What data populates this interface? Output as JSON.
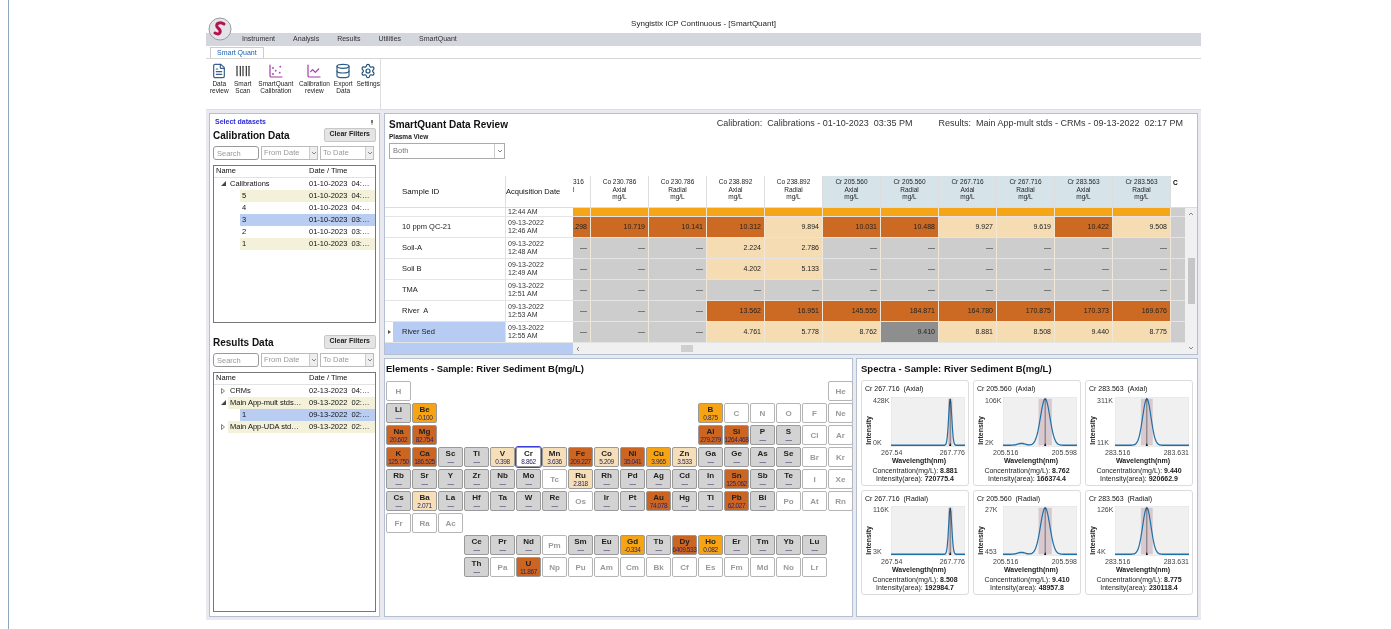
{
  "window": {
    "title": "Syngistix ICP Continuous - [SmartQuant]"
  },
  "menu": [
    "Instrument",
    "Analysis",
    "Results",
    "Utilities",
    "SmartQuant"
  ],
  "ribbon": {
    "tabs": [
      {
        "label": "Smart Quant",
        "selected": true
      }
    ],
    "buttons": [
      {
        "label": "Data review",
        "kind": "document"
      },
      {
        "label": "Smart Scan",
        "kind": "barcode"
      },
      {
        "label": "SmartQuant Calibration",
        "kind": "scatter"
      },
      {
        "label": "Calibration review",
        "kind": "line"
      },
      {
        "label": "Export Data",
        "kind": "database"
      },
      {
        "label": "Settings",
        "kind": "gear"
      }
    ]
  },
  "datasets": {
    "link": "Select datasets",
    "calibration": {
      "title": "Calibration Data",
      "clear": "Clear Filters",
      "search_placeholder": "Search",
      "from_placeholder": "From Date",
      "to_placeholder": "To Date",
      "columns": [
        "Name",
        "Date / Time"
      ],
      "tree": [
        {
          "name": "Calibrations",
          "date": "01-10-2023  04:…",
          "expanded": true,
          "selected": false,
          "tinted": false,
          "children": [
            {
              "name": "5",
              "date": "01-10-2023  04:…",
              "selected": false,
              "tinted": true
            },
            {
              "name": "4",
              "date": "01-10-2023  04:…",
              "selected": false,
              "tinted": false
            },
            {
              "name": "3",
              "date": "01-10-2023  03:…",
              "selected": true,
              "tinted": false
            },
            {
              "name": "2",
              "date": "01-10-2023  03:…",
              "selected": false,
              "tinted": false
            },
            {
              "name": "1",
              "date": "01-10-2023  03:…",
              "selected": false,
              "tinted": true
            }
          ]
        }
      ]
    },
    "results": {
      "title": "Results Data",
      "clear": "Clear Filters",
      "search_placeholder": "Search",
      "from_placeholder": "From Date",
      "to_placeholder": "To Date",
      "columns": [
        "Name",
        "Date / Time"
      ],
      "tree": [
        {
          "name": "CRMs",
          "date": "02-13-2023  04:…",
          "expanded": false,
          "selected": false,
          "tinted": false
        },
        {
          "name": "Main App-mult stds…",
          "date": "09-13-2022  02:…",
          "expanded": true,
          "selected": false,
          "tinted": true,
          "children": [
            {
              "name": "1",
              "date": "09-13-2022  02:…",
              "selected": true,
              "tinted": false
            }
          ]
        },
        {
          "name": "Main App-UDA std…",
          "date": "09-13-2022  02:…",
          "expanded": false,
          "selected": false,
          "tinted": true
        }
      ]
    }
  },
  "review": {
    "title": "SmartQuant Data Review",
    "plasma_label": "Plasma View",
    "plasma_value": "Both",
    "calibration_info": "Calibration:  Calibrations - 01-10-2023  03:35 PM",
    "results_info": "Results:  Main App-mult stds - CRMs - 09-13-2022  02:17 PM",
    "table": {
      "columns": [
        "Sample ID",
        "Acquisition Date"
      ],
      "data_columns": [
        {
          "lines": [
            "316",
            "l"
          ],
          "partial": true,
          "highlighted": false
        },
        {
          "lines": [
            "Co 230.786",
            "Axial",
            "mg/L"
          ],
          "partial": false,
          "highlighted": false
        },
        {
          "lines": [
            "Co 230.786",
            "Radial",
            "mg/L"
          ],
          "partial": false,
          "highlighted": false
        },
        {
          "lines": [
            "Co 238.892",
            "Axial",
            "mg/L"
          ],
          "partial": false,
          "highlighted": false
        },
        {
          "lines": [
            "Co 238.892",
            "Radial",
            "mg/L"
          ],
          "partial": false,
          "highlighted": false
        },
        {
          "lines": [
            "Cr 205.560",
            "Axial",
            "mg/L"
          ],
          "partial": false,
          "highlighted": true
        },
        {
          "lines": [
            "Cr 205.560",
            "Radial",
            "mg/L"
          ],
          "partial": false,
          "highlighted": true
        },
        {
          "lines": [
            "Cr 267.716",
            "Axial",
            "mg/L"
          ],
          "partial": false,
          "highlighted": true
        },
        {
          "lines": [
            "Cr 267.716",
            "Radial",
            "mg/L"
          ],
          "partial": false,
          "highlighted": true
        },
        {
          "lines": [
            "Cr 283.563",
            "Axial",
            "mg/L"
          ],
          "partial": false,
          "highlighted": true
        },
        {
          "lines": [
            "Cr 283.563",
            "Radial",
            "mg/L"
          ],
          "partial": false,
          "highlighted": true
        },
        {
          "lines": [
            "C"
          ],
          "partial": true,
          "highlighted": false
        }
      ],
      "rows": [
        {
          "partial": true,
          "time": "12:44 AM",
          "selected": false,
          "cells": [
            {
              "color": "#f6a516"
            },
            {
              "color": "#f6a516"
            },
            {
              "color": "#f6a516"
            },
            {
              "color": "#f6a516"
            },
            {
              "color": "#f6a516"
            },
            {
              "color": "#f6a516"
            },
            {
              "color": "#f6a516"
            },
            {
              "color": "#f6a516"
            },
            {
              "color": "#f6a516"
            },
            {
              "color": "#f6a516"
            },
            {
              "color": "#f6a516"
            }
          ]
        },
        {
          "partial": false,
          "sample": "10 ppm QC-21",
          "date": "09-13-2022",
          "time": "12:46 AM",
          "selected": false,
          "cells": [
            {
              "color": "#cc6a24",
              "value": ".298"
            },
            {
              "color": "#cc6a24",
              "value": "10.719"
            },
            {
              "color": "#cc6a24",
              "value": "10.141"
            },
            {
              "color": "#cc6a24",
              "value": "10.312"
            },
            {
              "color": "#f5dcb2",
              "value": "9.894"
            },
            {
              "color": "#cc6a24",
              "value": "10.031"
            },
            {
              "color": "#cc6a24",
              "value": "10.488"
            },
            {
              "color": "#f5dcb2",
              "value": "9.927"
            },
            {
              "color": "#f5dcb2",
              "value": "9.619"
            },
            {
              "color": "#cc6a24",
              "value": "10.422"
            },
            {
              "color": "#f5dcb2",
              "value": "9.508"
            }
          ]
        },
        {
          "partial": false,
          "sample": "Soil-A",
          "date": "09-13-2022",
          "time": "12:48 AM",
          "selected": false,
          "cells": [
            {
              "color": "#cdcdcd",
              "value": "—"
            },
            {
              "color": "#cdcdcd",
              "value": "—"
            },
            {
              "color": "#cdcdcd",
              "value": "—"
            },
            {
              "color": "#f5dcb2",
              "value": "2.224"
            },
            {
              "color": "#f5dcb2",
              "value": "2.786"
            },
            {
              "color": "#cdcdcd",
              "value": "—"
            },
            {
              "color": "#cdcdcd",
              "value": "—"
            },
            {
              "color": "#cdcdcd",
              "value": "—"
            },
            {
              "color": "#cdcdcd",
              "value": "—"
            },
            {
              "color": "#cdcdcd",
              "value": "—"
            },
            {
              "color": "#cdcdcd",
              "value": "—"
            }
          ]
        },
        {
          "partial": false,
          "sample": "Soil B",
          "date": "09-13-2022",
          "time": "12:49 AM",
          "selected": false,
          "cells": [
            {
              "color": "#cdcdcd",
              "value": "—"
            },
            {
              "color": "#cdcdcd",
              "value": "—"
            },
            {
              "color": "#cdcdcd",
              "value": "—"
            },
            {
              "color": "#f5dcb2",
              "value": "4.202"
            },
            {
              "color": "#f5dcb2",
              "value": "5.133"
            },
            {
              "color": "#cdcdcd",
              "value": "—"
            },
            {
              "color": "#cdcdcd",
              "value": "—"
            },
            {
              "color": "#cdcdcd",
              "value": "—"
            },
            {
              "color": "#cdcdcd",
              "value": "—"
            },
            {
              "color": "#cdcdcd",
              "value": "—"
            },
            {
              "color": "#cdcdcd",
              "value": "—"
            }
          ]
        },
        {
          "partial": false,
          "sample": "TMA",
          "date": "09-13-2022",
          "time": "12:51 AM",
          "selected": false,
          "cells": [
            {
              "color": "#cdcdcd",
              "value": "—"
            },
            {
              "color": "#cdcdcd",
              "value": "—"
            },
            {
              "color": "#cdcdcd",
              "value": "—"
            },
            {
              "color": "#cdcdcd",
              "value": "—"
            },
            {
              "color": "#cdcdcd",
              "value": "—"
            },
            {
              "color": "#cdcdcd",
              "value": "—"
            },
            {
              "color": "#cdcdcd",
              "value": "—"
            },
            {
              "color": "#cdcdcd",
              "value": "—"
            },
            {
              "color": "#cdcdcd",
              "value": "—"
            },
            {
              "color": "#cdcdcd",
              "value": "—"
            },
            {
              "color": "#cdcdcd",
              "value": "—"
            }
          ]
        },
        {
          "partial": false,
          "sample": "River  A",
          "date": "09-13-2022",
          "time": "12:53 AM",
          "selected": false,
          "cells": [
            {
              "color": "#cdcdcd",
              "value": "—"
            },
            {
              "color": "#cdcdcd",
              "value": "—"
            },
            {
              "color": "#cdcdcd",
              "value": "—"
            },
            {
              "color": "#cc6a24",
              "value": "13.562"
            },
            {
              "color": "#cc6a24",
              "value": "16.951"
            },
            {
              "color": "#cc6a24",
              "value": "145.555"
            },
            {
              "color": "#cc6a24",
              "value": "184.871"
            },
            {
              "color": "#cc6a24",
              "value": "164.780"
            },
            {
              "color": "#cc6a24",
              "value": "170.875"
            },
            {
              "color": "#cc6a24",
              "value": "170.373"
            },
            {
              "color": "#cc6a24",
              "value": "169.676"
            }
          ]
        },
        {
          "partial": false,
          "sample": "River Sed",
          "date": "09-13-2022",
          "time": "12:55 AM",
          "selected": true,
          "cells": [
            {
              "color": "#cdcdcd",
              "value": "—"
            },
            {
              "color": "#cdcdcd",
              "value": "—"
            },
            {
              "color": "#cdcdcd",
              "value": "—"
            },
            {
              "color": "#f5dcb2",
              "value": "4.761"
            },
            {
              "color": "#f5dcb2",
              "value": "5.778"
            },
            {
              "color": "#f5dcb2",
              "value": "8.762"
            },
            {
              "color": "#8e8e8e",
              "value": "9.410"
            },
            {
              "color": "#f5dcb2",
              "value": "8.881"
            },
            {
              "color": "#f5dcb2",
              "value": "8.508"
            },
            {
              "color": "#f5dcb2",
              "value": "9.440"
            },
            {
              "color": "#f5dcb2",
              "value": "8.775"
            }
          ]
        }
      ]
    }
  },
  "elements": {
    "title": "Elements - Sample: River Sediment B(mg/L)",
    "rows": [
      [
        {
          "symbol": "H",
          "color": "#ffffff",
          "selected": false
        },
        null,
        null,
        null,
        null,
        null,
        null,
        null,
        null,
        null,
        null,
        null,
        null,
        null,
        null,
        null,
        null,
        {
          "symbol": "He",
          "color": "#ffffff",
          "selected": false
        }
      ],
      [
        {
          "symbol": "Li",
          "color": "#d3d3d3",
          "value": "—",
          "selected": false
        },
        {
          "symbol": "Be",
          "color": "#f6a414",
          "value": "-0.100",
          "selected": false
        },
        null,
        null,
        null,
        null,
        null,
        null,
        null,
        null,
        null,
        null,
        {
          "symbol": "B",
          "color": "#f6a414",
          "value": "0.875",
          "selected": false
        },
        {
          "symbol": "C",
          "color": "#ffffff",
          "selected": false
        },
        {
          "symbol": "N",
          "color": "#ffffff",
          "selected": false
        },
        {
          "symbol": "O",
          "color": "#ffffff",
          "selected": false
        },
        {
          "symbol": "F",
          "color": "#ffffff",
          "selected": false
        },
        {
          "symbol": "Ne",
          "color": "#ffffff",
          "selected": false
        }
      ],
      [
        {
          "symbol": "Na",
          "color": "#cd6522",
          "value": "20.602",
          "selected": false
        },
        {
          "symbol": "Mg",
          "color": "#cd6522",
          "value": "82.754",
          "selected": false
        },
        null,
        null,
        null,
        null,
        null,
        null,
        null,
        null,
        null,
        null,
        {
          "symbol": "Al",
          "color": "#cd6522",
          "value": "279.279",
          "selected": false
        },
        {
          "symbol": "Si",
          "color": "#cd6522",
          "value": "1264.468",
          "selected": false
        },
        {
          "symbol": "P",
          "color": "#d3d3d3",
          "value": "—",
          "selected": false
        },
        {
          "symbol": "S",
          "color": "#d3d3d3",
          "value": "—",
          "selected": false
        },
        {
          "symbol": "Cl",
          "color": "#ffffff",
          "selected": false
        },
        {
          "symbol": "Ar",
          "color": "#ffffff",
          "selected": false
        }
      ],
      [
        {
          "symbol": "K",
          "color": "#cd6522",
          "value": "125.750",
          "selected": false
        },
        {
          "symbol": "Ca",
          "color": "#cd6522",
          "value": "186.525",
          "selected": false
        },
        {
          "symbol": "Sc",
          "color": "#d3d3d3",
          "value": "—",
          "selected": false
        },
        {
          "symbol": "Ti",
          "color": "#d3d3d3",
          "value": "—",
          "selected": false
        },
        {
          "symbol": "V",
          "color": "#f6dfb8",
          "value": "0.398",
          "selected": false
        },
        {
          "symbol": "Cr",
          "color": "#ffffff",
          "value": "8.862",
          "selected": true
        },
        {
          "symbol": "Mn",
          "color": "#f6dfb8",
          "value": "3.636",
          "selected": false
        },
        {
          "symbol": "Fe",
          "color": "#cd6522",
          "value": "209.227",
          "selected": false
        },
        {
          "symbol": "Co",
          "color": "#f6dfb8",
          "value": "5.209",
          "selected": false
        },
        {
          "symbol": "Ni",
          "color": "#cd6522",
          "value": "35.041",
          "selected": false
        },
        {
          "symbol": "Cu",
          "color": "#f6a414",
          "value": "3.965",
          "selected": false
        },
        {
          "symbol": "Zn",
          "color": "#f6dfb8",
          "value": "3.533",
          "selected": false
        },
        {
          "symbol": "Ga",
          "color": "#d3d3d3",
          "value": "—",
          "selected": false
        },
        {
          "symbol": "Ge",
          "color": "#d3d3d3",
          "value": "—",
          "selected": false
        },
        {
          "symbol": "As",
          "color": "#d3d3d3",
          "value": "—",
          "selected": false
        },
        {
          "symbol": "Se",
          "color": "#d3d3d3",
          "value": "—",
          "selected": false
        },
        {
          "symbol": "Br",
          "color": "#ffffff",
          "selected": false
        },
        {
          "symbol": "Kr",
          "color": "#ffffff",
          "selected": false
        }
      ],
      [
        {
          "symbol": "Rb",
          "color": "#d3d3d3",
          "value": "—",
          "selected": false
        },
        {
          "symbol": "Sr",
          "color": "#d3d3d3",
          "value": "—",
          "selected": false
        },
        {
          "symbol": "Y",
          "color": "#d3d3d3",
          "value": "—",
          "selected": false
        },
        {
          "symbol": "Zr",
          "color": "#d3d3d3",
          "value": "—",
          "selected": false
        },
        {
          "symbol": "Nb",
          "color": "#d3d3d3",
          "value": "—",
          "selected": false
        },
        {
          "symbol": "Mo",
          "color": "#d3d3d3",
          "value": "—",
          "selected": false
        },
        {
          "symbol": "Tc",
          "color": "#ffffff",
          "selected": false
        },
        {
          "symbol": "Ru",
          "color": "#f6dfb8",
          "value": "2.818",
          "selected": false
        },
        {
          "symbol": "Rh",
          "color": "#d3d3d3",
          "value": "—",
          "selected": false
        },
        {
          "symbol": "Pd",
          "color": "#d3d3d3",
          "value": "—",
          "selected": false
        },
        {
          "symbol": "Ag",
          "color": "#d3d3d3",
          "value": "—",
          "selected": false
        },
        {
          "symbol": "Cd",
          "color": "#d3d3d3",
          "value": "—",
          "selected": false
        },
        {
          "symbol": "In",
          "color": "#d3d3d3",
          "value": "—",
          "selected": false
        },
        {
          "symbol": "Sn",
          "color": "#cd6522",
          "value": "125.062",
          "selected": false
        },
        {
          "symbol": "Sb",
          "color": "#d3d3d3",
          "value": "—",
          "selected": false
        },
        {
          "symbol": "Te",
          "color": "#d3d3d3",
          "value": "—",
          "selected": false
        },
        {
          "symbol": "I",
          "color": "#ffffff",
          "selected": false
        },
        {
          "symbol": "Xe",
          "color": "#ffffff",
          "selected": false
        }
      ],
      [
        {
          "symbol": "Cs",
          "color": "#d3d3d3",
          "value": "—",
          "selected": false
        },
        {
          "symbol": "Ba",
          "color": "#f6dfb8",
          "value": "2.071",
          "selected": false
        },
        {
          "symbol": "La",
          "color": "#d3d3d3",
          "value": "—",
          "selected": false
        },
        {
          "symbol": "Hf",
          "color": "#d3d3d3",
          "value": "—",
          "selected": false
        },
        {
          "symbol": "Ta",
          "color": "#d3d3d3",
          "value": "—",
          "selected": false
        },
        {
          "symbol": "W",
          "color": "#d3d3d3",
          "value": "—",
          "selected": false
        },
        {
          "symbol": "Re",
          "color": "#d3d3d3",
          "value": "—",
          "selected": false
        },
        {
          "symbol": "Os",
          "color": "#ffffff",
          "selected": false
        },
        {
          "symbol": "Ir",
          "color": "#d3d3d3",
          "value": "—",
          "selected": false
        },
        {
          "symbol": "Pt",
          "color": "#d3d3d3",
          "value": "—",
          "selected": false
        },
        {
          "symbol": "Au",
          "color": "#cd6522",
          "value": "74.078",
          "selected": false
        },
        {
          "symbol": "Hg",
          "color": "#d3d3d3",
          "value": "—",
          "selected": false
        },
        {
          "symbol": "Tl",
          "color": "#d3d3d3",
          "value": "—",
          "selected": false
        },
        {
          "symbol": "Pb",
          "color": "#cd6522",
          "value": "62.027",
          "selected": false
        },
        {
          "symbol": "Bi",
          "color": "#d3d3d3",
          "value": "—",
          "selected": false
        },
        {
          "symbol": "Po",
          "color": "#ffffff",
          "selected": false
        },
        {
          "symbol": "At",
          "color": "#ffffff",
          "selected": false
        },
        {
          "symbol": "Rn",
          "color": "#ffffff",
          "selected": false
        }
      ],
      [
        {
          "symbol": "Fr",
          "color": "#ffffff",
          "selected": false
        },
        {
          "symbol": "Ra",
          "color": "#ffffff",
          "selected": false
        },
        {
          "symbol": "Ac",
          "color": "#ffffff",
          "selected": false
        }
      ],
      [
        null,
        null,
        null,
        {
          "symbol": "Ce",
          "color": "#d3d3d3",
          "value": "—",
          "selected": false
        },
        {
          "symbol": "Pr",
          "color": "#d3d3d3",
          "value": "—",
          "selected": false
        },
        {
          "symbol": "Nd",
          "color": "#d3d3d3",
          "value": "—",
          "selected": false
        },
        {
          "symbol": "Pm",
          "color": "#ffffff",
          "selected": false
        },
        {
          "symbol": "Sm",
          "color": "#d3d3d3",
          "value": "—",
          "selected": false
        },
        {
          "symbol": "Eu",
          "color": "#d3d3d3",
          "value": "—",
          "selected": false
        },
        {
          "symbol": "Gd",
          "color": "#f6a414",
          "value": "-0.334",
          "selected": false
        },
        {
          "symbol": "Tb",
          "color": "#d3d3d3",
          "value": "—",
          "selected": false
        },
        {
          "symbol": "Dy",
          "color": "#cd6522",
          "value": "6409.533",
          "selected": false
        },
        {
          "symbol": "Ho",
          "color": "#f6a414",
          "value": "0.082",
          "selected": false
        },
        {
          "symbol": "Er",
          "color": "#d3d3d3",
          "value": "—",
          "selected": false
        },
        {
          "symbol": "Tm",
          "color": "#d3d3d3",
          "value": "—",
          "selected": false
        },
        {
          "symbol": "Yb",
          "color": "#d3d3d3",
          "value": "—",
          "selected": false
        },
        {
          "symbol": "Lu",
          "color": "#d3d3d3",
          "value": "—",
          "selected": false
        }
      ],
      [
        null,
        null,
        null,
        {
          "symbol": "Th",
          "color": "#d3d3d3",
          "value": "—",
          "selected": false
        },
        {
          "symbol": "Pa",
          "color": "#ffffff",
          "selected": false
        },
        {
          "symbol": "U",
          "color": "#cd6522",
          "value": "11.867",
          "selected": false
        },
        {
          "symbol": "Np",
          "color": "#ffffff",
          "selected": false
        },
        {
          "symbol": "Pu",
          "color": "#ffffff",
          "selected": false
        },
        {
          "symbol": "Am",
          "color": "#ffffff",
          "selected": false
        },
        {
          "symbol": "Cm",
          "color": "#ffffff",
          "selected": false
        },
        {
          "symbol": "Bk",
          "color": "#ffffff",
          "selected": false
        },
        {
          "symbol": "Cf",
          "color": "#ffffff",
          "selected": false
        },
        {
          "symbol": "Es",
          "color": "#ffffff",
          "selected": false
        },
        {
          "symbol": "Fm",
          "color": "#ffffff",
          "selected": false
        },
        {
          "symbol": "Md",
          "color": "#ffffff",
          "selected": false
        },
        {
          "symbol": "No",
          "color": "#ffffff",
          "selected": false
        },
        {
          "symbol": "Lr",
          "color": "#ffffff",
          "selected": false
        }
      ]
    ]
  },
  "spectra": {
    "title": "Spectra - Sample: River Sediment B(mg/L)",
    "plots": [
      {
        "title": "Cr 267.716  (Axial)",
        "y_max": "428K",
        "y_min": "0K",
        "x_min": "267.54",
        "x_max": "267.776",
        "y_label": "Intensity",
        "x_label": "Wavelength(nm)",
        "footer": "Concentration(mg/L): **8.881**  Intensity(area): **720775.4**"
      },
      {
        "title": "Cr 205.560  (Axial)",
        "y_max": "106K",
        "y_min": "2K",
        "x_min": "205.516",
        "x_max": "205.598",
        "y_label": "Intensity",
        "x_label": "Wavelength(nm)",
        "footer": "Concentration(mg/L): **8.762**  Intensity(area): **166374.4**"
      },
      {
        "title": "Cr 283.563  (Axial)",
        "y_max": "311K",
        "y_min": "11K",
        "x_min": "283.516",
        "x_max": "283.631",
        "y_label": "Intensity",
        "x_label": "Wavelength(nm)",
        "footer": "Concentration(mg/L): **9.440**  Intensity(area): **920662.9**"
      },
      {
        "title": "Cr 267.716  (Radial)",
        "y_max": "116K",
        "y_min": "3K",
        "x_min": "267.54",
        "x_max": "267.776",
        "y_label": "Intensity",
        "x_label": "Wavelength(nm)",
        "footer": "Concentration(mg/L): **8.508**  Intensity(area): **192984.7**"
      },
      {
        "title": "Cr 205.560  (Radial)",
        "y_max": "27K",
        "y_min": "453",
        "x_min": "205.516",
        "x_max": "205.598",
        "y_label": "Intensity",
        "x_label": "Wavelength(nm)",
        "footer": "Concentration(mg/L): **9.410**  Intensity(area): **48957.8**"
      },
      {
        "title": "Cr 283.563  (Radial)",
        "y_max": "126K",
        "y_min": "4K",
        "x_min": "283.516",
        "x_max": "283.631",
        "y_label": "Intensity",
        "x_label": "Wavelength(nm)",
        "footer": "Concentration(mg/L): **8.775**  Intensity(area): **230118.4**"
      }
    ]
  }
}
